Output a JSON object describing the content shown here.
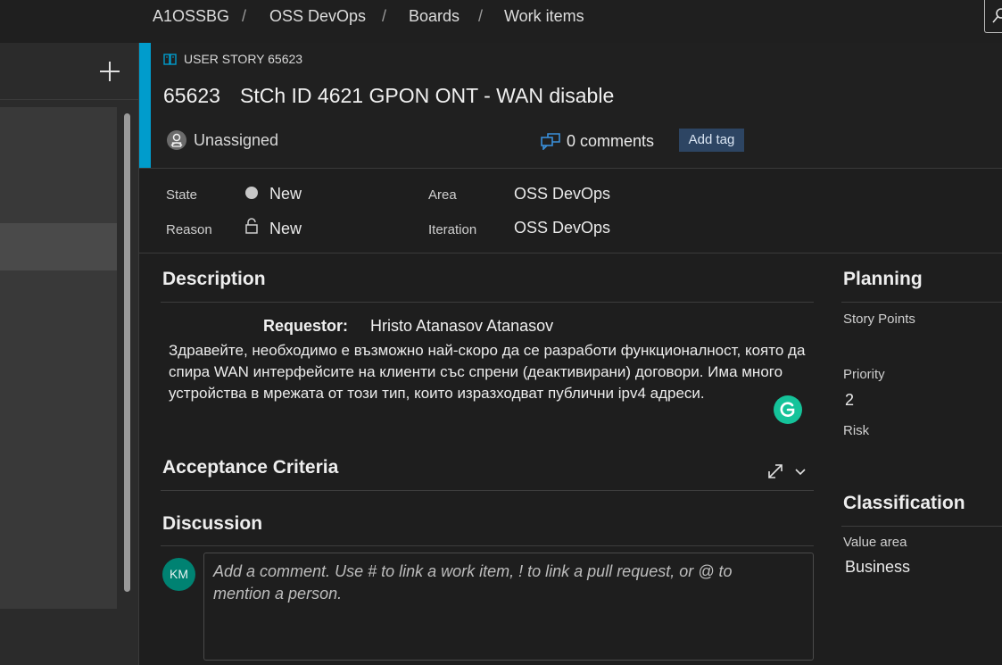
{
  "breadcrumb": {
    "items": [
      "A1OSSBG",
      "OSS DevOps",
      "Boards",
      "Work items"
    ],
    "separator": "/"
  },
  "left_panel": {
    "add_icon": "plus-icon"
  },
  "work_item": {
    "type_label": "USER STORY 65623",
    "type_icon": "book-icon",
    "accent_color": "#009ccc",
    "id": "65623",
    "title": "StCh ID 4621 GPON ONT - WAN disable",
    "assignee": "Unassigned",
    "comments": "0 comments",
    "add_tag": "Add tag"
  },
  "fields": {
    "state_label": "State",
    "state_value": "New",
    "reason_label": "Reason",
    "reason_value": "New",
    "area_label": "Area",
    "area_value": "OSS DevOps",
    "iteration_label": "Iteration",
    "iteration_value": "OSS DevOps"
  },
  "description": {
    "title": "Description",
    "requestor_label": "Requestor:",
    "requestor_value": "Hristo Atanasov Atanasov",
    "body": "Здравейте, необходимо е възможно най-скоро да се разработи функционалност, която да спира WAN интерфейсите на клиенти със спрени (деактивирани) договори. Има много устройства в мрежата от този тип, които изразходват публични ipv4 адреси."
  },
  "acceptance": {
    "title": "Acceptance Criteria"
  },
  "discussion": {
    "title": "Discussion",
    "avatar_initials": "KM",
    "placeholder": "Add a comment. Use # to link a work item, ! to link a pull request, or @ to mention a person."
  },
  "planning": {
    "title": "Planning",
    "story_points_label": "Story Points",
    "priority_label": "Priority",
    "priority_value": "2",
    "risk_label": "Risk"
  },
  "classification": {
    "title": "Classification",
    "value_area_label": "Value area",
    "value_area_value": "Business"
  }
}
